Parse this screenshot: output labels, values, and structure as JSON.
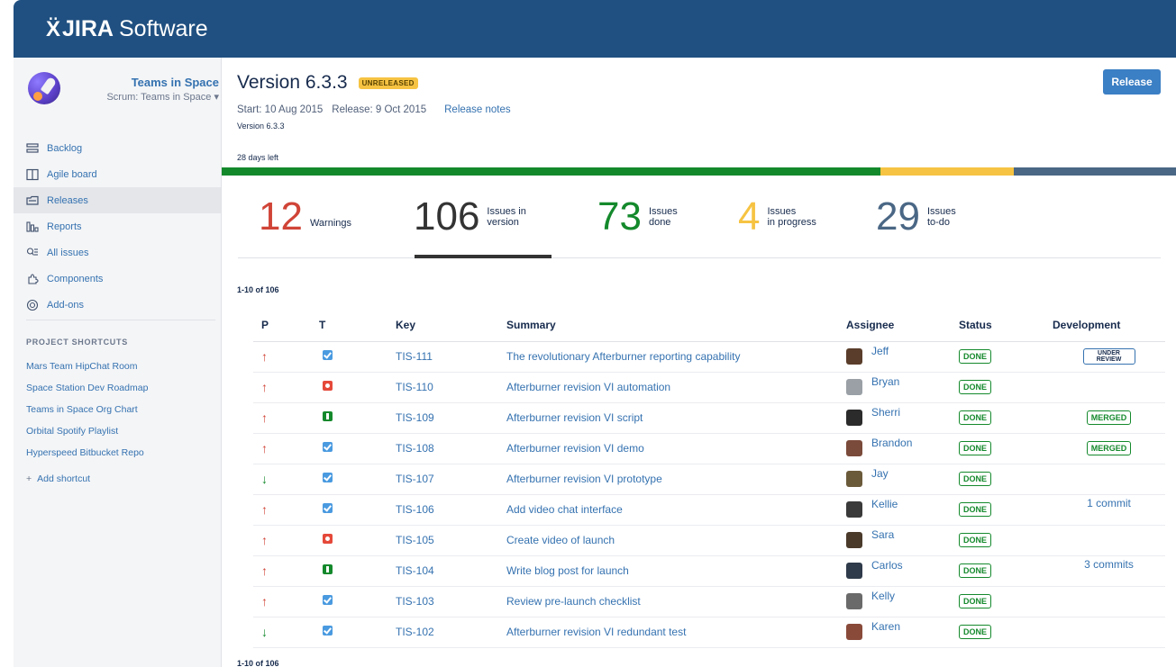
{
  "app": {
    "logo_mark": "Ẍ",
    "brand": "JIRA",
    "product": "Software"
  },
  "project": {
    "name": "Teams in Space",
    "board": "Scrum: Teams in Space ▾"
  },
  "nav": [
    {
      "label": "Backlog",
      "icon": "backlog-icon"
    },
    {
      "label": "Agile board",
      "icon": "board-icon"
    },
    {
      "label": "Releases",
      "icon": "releases-icon",
      "active": true
    },
    {
      "label": "Reports",
      "icon": "reports-icon"
    },
    {
      "label": "All issues",
      "icon": "issues-icon"
    },
    {
      "label": "Components",
      "icon": "components-icon"
    },
    {
      "label": "Add-ons",
      "icon": "addons-icon"
    }
  ],
  "shortcuts": {
    "title": "PROJECT SHORTCUTS",
    "items": [
      "Mars Team HipChat Room",
      "Space Station Dev Roadmap",
      "Teams in Space Org Chart",
      "Orbital Spotify Playlist",
      "Hyperspeed Bitbucket Repo"
    ],
    "add_label": "Add shortcut",
    "add_glyph": "+"
  },
  "version": {
    "title": "Version 6.3.3",
    "status": "UNRELEASED",
    "start": "Start: 10 Aug 2015",
    "release": "Release: 9 Oct 2015",
    "notes_link": "Release notes",
    "description": "Version 6.3.3",
    "days_left": "28 days left",
    "release_button": "Release"
  },
  "progress": {
    "done_fraction": 0.69,
    "in_progress_fraction": 0.14,
    "todo_fraction": 0.17,
    "colors": {
      "done": "#14892c",
      "in_progress": "#f6c342",
      "todo": "#4a6785"
    }
  },
  "stats": [
    {
      "value": "12",
      "label1": "Warnings",
      "label2": "",
      "color": "#d04437"
    },
    {
      "value": "106",
      "label1": "Issues in",
      "label2": "version",
      "color": "#333333"
    },
    {
      "value": "73",
      "label1": "Issues",
      "label2": "done",
      "color": "#14892c"
    },
    {
      "value": "4",
      "label1": "Issues",
      "label2": "in progress",
      "color": "#f6c342"
    },
    {
      "value": "29",
      "label1": "Issues",
      "label2": "to-do",
      "color": "#4a6785"
    }
  ],
  "pagination": {
    "top": "1-10 of 106",
    "bottom": "1-10 of 106"
  },
  "table": {
    "headers": {
      "p": "P",
      "t": "T",
      "key": "Key",
      "summary": "Summary",
      "assignee": "Assignee",
      "status": "Status",
      "development": "Development"
    },
    "rows": [
      {
        "prio": "up",
        "prio_glyph": "↑",
        "type": "task",
        "key": "TIS-111",
        "summary": "The revolutionary Afterburner reporting capability",
        "assignee": "Jeff",
        "status": "DONE",
        "dev_kind": "review",
        "dev": "UNDER\nREVIEW"
      },
      {
        "prio": "up",
        "prio_glyph": "↑",
        "type": "bug",
        "key": "TIS-110",
        "summary": "Afterburner revision VI automation",
        "assignee": "Bryan",
        "status": "DONE",
        "dev_kind": "none",
        "dev": ""
      },
      {
        "prio": "up",
        "prio_glyph": "↑",
        "type": "story",
        "key": "TIS-109",
        "summary": "Afterburner revision VI script",
        "assignee": "Sherri",
        "status": "DONE",
        "dev_kind": "merged",
        "dev": "MERGED"
      },
      {
        "prio": "up",
        "prio_glyph": "↑",
        "type": "task",
        "key": "TIS-108",
        "summary": "Afterburner revision VI demo",
        "assignee": "Brandon",
        "status": "DONE",
        "dev_kind": "merged",
        "dev": "MERGED"
      },
      {
        "prio": "down",
        "prio_glyph": "↓",
        "type": "task",
        "key": "TIS-107",
        "summary": "Afterburner revision VI prototype",
        "assignee": "Jay",
        "status": "DONE",
        "dev_kind": "none",
        "dev": ""
      },
      {
        "prio": "up",
        "prio_glyph": "↑",
        "type": "task",
        "key": "TIS-106",
        "summary": "Add video chat interface",
        "assignee": "Kellie",
        "status": "DONE",
        "dev_kind": "commit",
        "dev": "1 commit"
      },
      {
        "prio": "up",
        "prio_glyph": "↑",
        "type": "bug",
        "key": "TIS-105",
        "summary": "Create video of launch",
        "assignee": "Sara",
        "status": "DONE",
        "dev_kind": "none",
        "dev": ""
      },
      {
        "prio": "up",
        "prio_glyph": "↑",
        "type": "story",
        "key": "TIS-104",
        "summary": "Write blog post for launch",
        "assignee": "Carlos",
        "status": "DONE",
        "dev_kind": "commit",
        "dev": "3 commits"
      },
      {
        "prio": "up",
        "prio_glyph": "↑",
        "type": "task",
        "key": "TIS-103",
        "summary": "Review pre-launch checklist",
        "assignee": "Kelly",
        "status": "DONE",
        "dev_kind": "none",
        "dev": ""
      },
      {
        "prio": "down",
        "prio_glyph": "↓",
        "type": "task",
        "key": "TIS-102",
        "summary": "Afterburner revision VI redundant test",
        "assignee": "Karen",
        "status": "DONE",
        "dev_kind": "none",
        "dev": ""
      }
    ]
  },
  "avatar_colors": [
    "#5a3d2b",
    "#9aa0a6",
    "#2b2b2b",
    "#7a4a3a",
    "#6b5a3a",
    "#3a3a3a",
    "#4a3a2a",
    "#2f3a4a",
    "#6a6a6a",
    "#8a4a3a"
  ],
  "accent": "#3b7fc4",
  "header_color": "#205081"
}
